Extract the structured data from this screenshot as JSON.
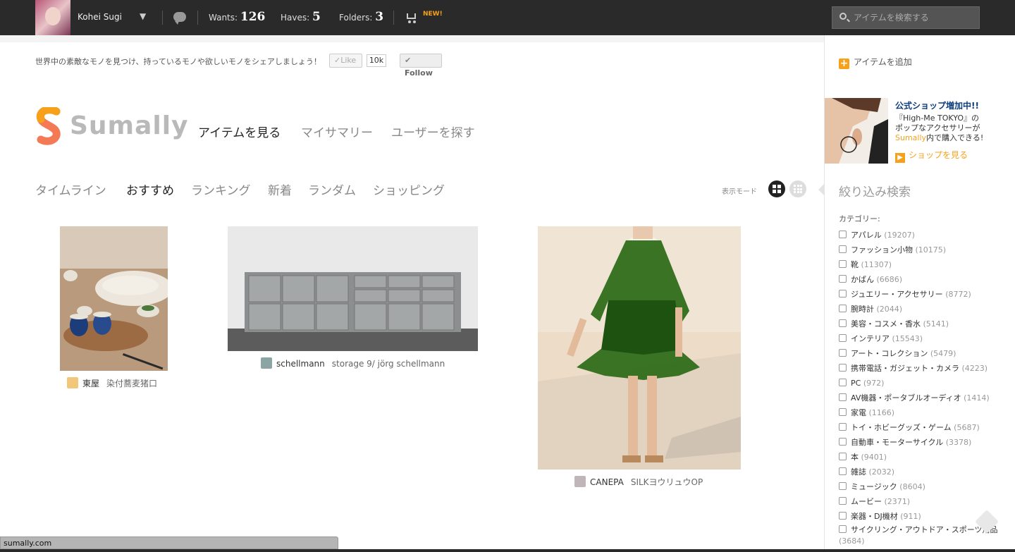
{
  "topbar": {
    "username": "Kohei Sugi",
    "caret": "▼",
    "wants_label": "Wants:",
    "wants_count": "126",
    "haves_label": "Haves:",
    "haves_count": "5",
    "folders_label": "Folders:",
    "folders_count": "3",
    "new_badge": "NEW!",
    "search_placeholder": "アイテムを検索する"
  },
  "social": {
    "tagline": "世界中の素敵なモノを見つけ、持っているモノや欲しいモノをシェアしましょう！",
    "like_label": "✓Like",
    "like_count": "10k",
    "follow_label": "Follow"
  },
  "brand": {
    "name": "Sumally"
  },
  "main_nav": [
    {
      "label": "アイテムを見る",
      "active": true
    },
    {
      "label": "マイサマリー",
      "active": false
    },
    {
      "label": "ユーザーを探す",
      "active": false
    }
  ],
  "sub_nav": [
    {
      "label": "タイムライン",
      "active": false
    },
    {
      "label": "おすすめ",
      "active": true
    },
    {
      "label": "ランキング",
      "active": false
    },
    {
      "label": "新着",
      "active": false
    },
    {
      "label": "ランダム",
      "active": false
    },
    {
      "label": "ショッピング",
      "active": false
    }
  ],
  "view_mode_label": "表示モード",
  "items": [
    {
      "user": "東屋",
      "name": "染付蕎麦猪口"
    },
    {
      "user": "schellmann",
      "name": "storage 9/ jörg schellmann"
    },
    {
      "user": "CANEPA",
      "name": "SILKヨウリュウOP"
    }
  ],
  "sidebar": {
    "add_item": "アイテムを追加",
    "promo_title": "公式ショップ増加中!!",
    "promo_line1": "『High-Me TOKYO』の",
    "promo_line2": "ポップなアクセサリーが",
    "promo_link": "Sumally",
    "promo_line3": "内で購入できる!",
    "promo_shop": "ショップを見る",
    "filter_title": "絞り込み検索",
    "category_label": "カテゴリー:",
    "categories": [
      {
        "name": "アパレル",
        "count": "(19207)"
      },
      {
        "name": "ファッション小物",
        "count": "(10175)"
      },
      {
        "name": "靴",
        "count": "(11307)"
      },
      {
        "name": "かばん",
        "count": "(6686)"
      },
      {
        "name": "ジュエリー・アクセサリー",
        "count": "(8772)"
      },
      {
        "name": "腕時計",
        "count": "(2044)"
      },
      {
        "name": "美容・コスメ・香水",
        "count": "(5141)"
      },
      {
        "name": "インテリア",
        "count": "(15543)"
      },
      {
        "name": "アート・コレクション",
        "count": "(5479)"
      },
      {
        "name": "携帯電話・ガジェット・カメラ",
        "count": "(4223)"
      },
      {
        "name": "PC",
        "count": "(972)"
      },
      {
        "name": "AV機器・ポータブルオーディオ",
        "count": "(1414)"
      },
      {
        "name": "家電",
        "count": "(1166)"
      },
      {
        "name": "トイ・ホビーグッズ・ゲーム",
        "count": "(5687)"
      },
      {
        "name": "自動車・モーターサイクル",
        "count": "(3378)"
      },
      {
        "name": "本",
        "count": "(9401)"
      },
      {
        "name": "雑誌",
        "count": "(2032)"
      },
      {
        "name": "ミュージック",
        "count": "(8604)"
      },
      {
        "name": "ムービー",
        "count": "(2371)"
      },
      {
        "name": "楽器・DJ機材",
        "count": "(911)"
      },
      {
        "name": "サイクリング・アウトドア・スポーツ用品",
        "count": "(3684)"
      }
    ]
  },
  "status_url": "sumally.com",
  "colors": {
    "accent": "#f7a11a",
    "topbar": "#2a2a2a",
    "promo_title": "#0c3d7e"
  }
}
